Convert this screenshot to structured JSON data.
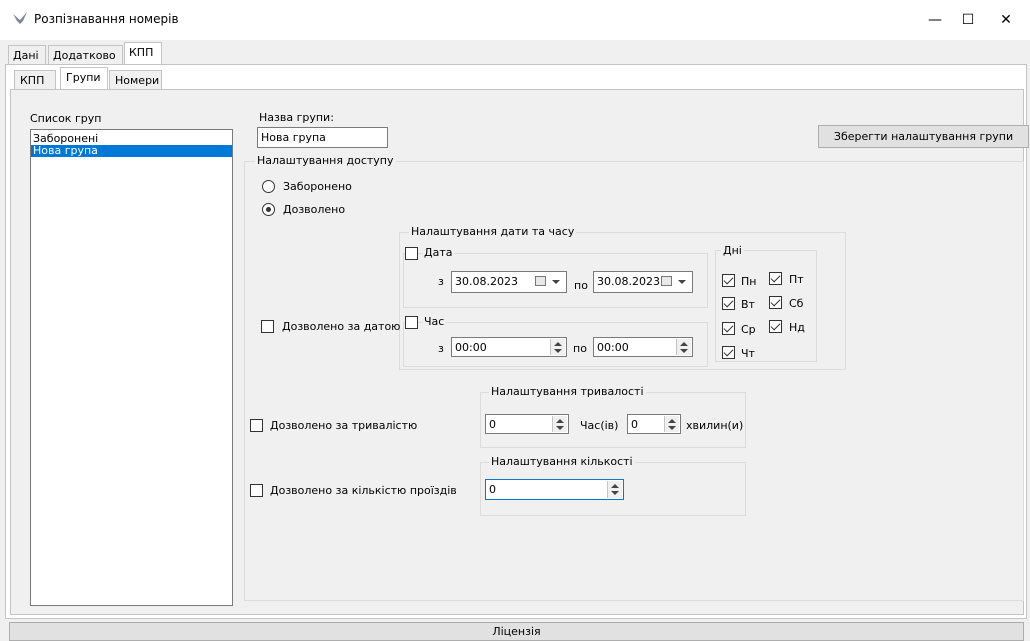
{
  "window": {
    "title": "Розпізнавання номерів",
    "minimize": "—",
    "maximize": "☐",
    "close": "✕"
  },
  "main_tabs": [
    "Дані",
    "Додатково",
    "КПП"
  ],
  "sub_tabs": [
    "КПП",
    "Групи",
    "Номери"
  ],
  "groups": {
    "list_label": "Список груп",
    "items": [
      "Заборонені",
      "Нова група"
    ],
    "selected": "Нова група"
  },
  "group_name": {
    "label": "Назва групи:",
    "value": "Нова група"
  },
  "save_button": "Зберегти налаштування групи",
  "access": {
    "title": "Налаштування доступу",
    "forbidden": "Заборонено",
    "allowed": "Дозволено",
    "by_date": "Дозволено за датою",
    "by_duration": "Дозволено за тривалістю",
    "by_count": "Дозволено за кількістю проїздів"
  },
  "datetime": {
    "title": "Налаштування дати та часу",
    "date_label": "Дата",
    "time_label": "Час",
    "from": "з",
    "to": "по",
    "date_from": "30.08.2023",
    "date_to": "30.08.2023",
    "time_from": "00:00",
    "time_to": "00:00"
  },
  "days": {
    "title": "Дні",
    "mon": "Пн",
    "tue": "Вт",
    "wed": "Ср",
    "thu": "Чт",
    "fri": "Пт",
    "sat": "Сб",
    "sun": "Нд"
  },
  "duration": {
    "title": "Налаштування тривалості",
    "hours": "0",
    "hours_label": "Час(ів)",
    "minutes": "0",
    "minutes_label": "хвилин(и)"
  },
  "count": {
    "title": "Налаштування кількості",
    "value": "0"
  },
  "status": {
    "license": "Ліцензія"
  },
  "colors": {
    "selection": "#0078d7",
    "panel": "#f0f0f0"
  }
}
